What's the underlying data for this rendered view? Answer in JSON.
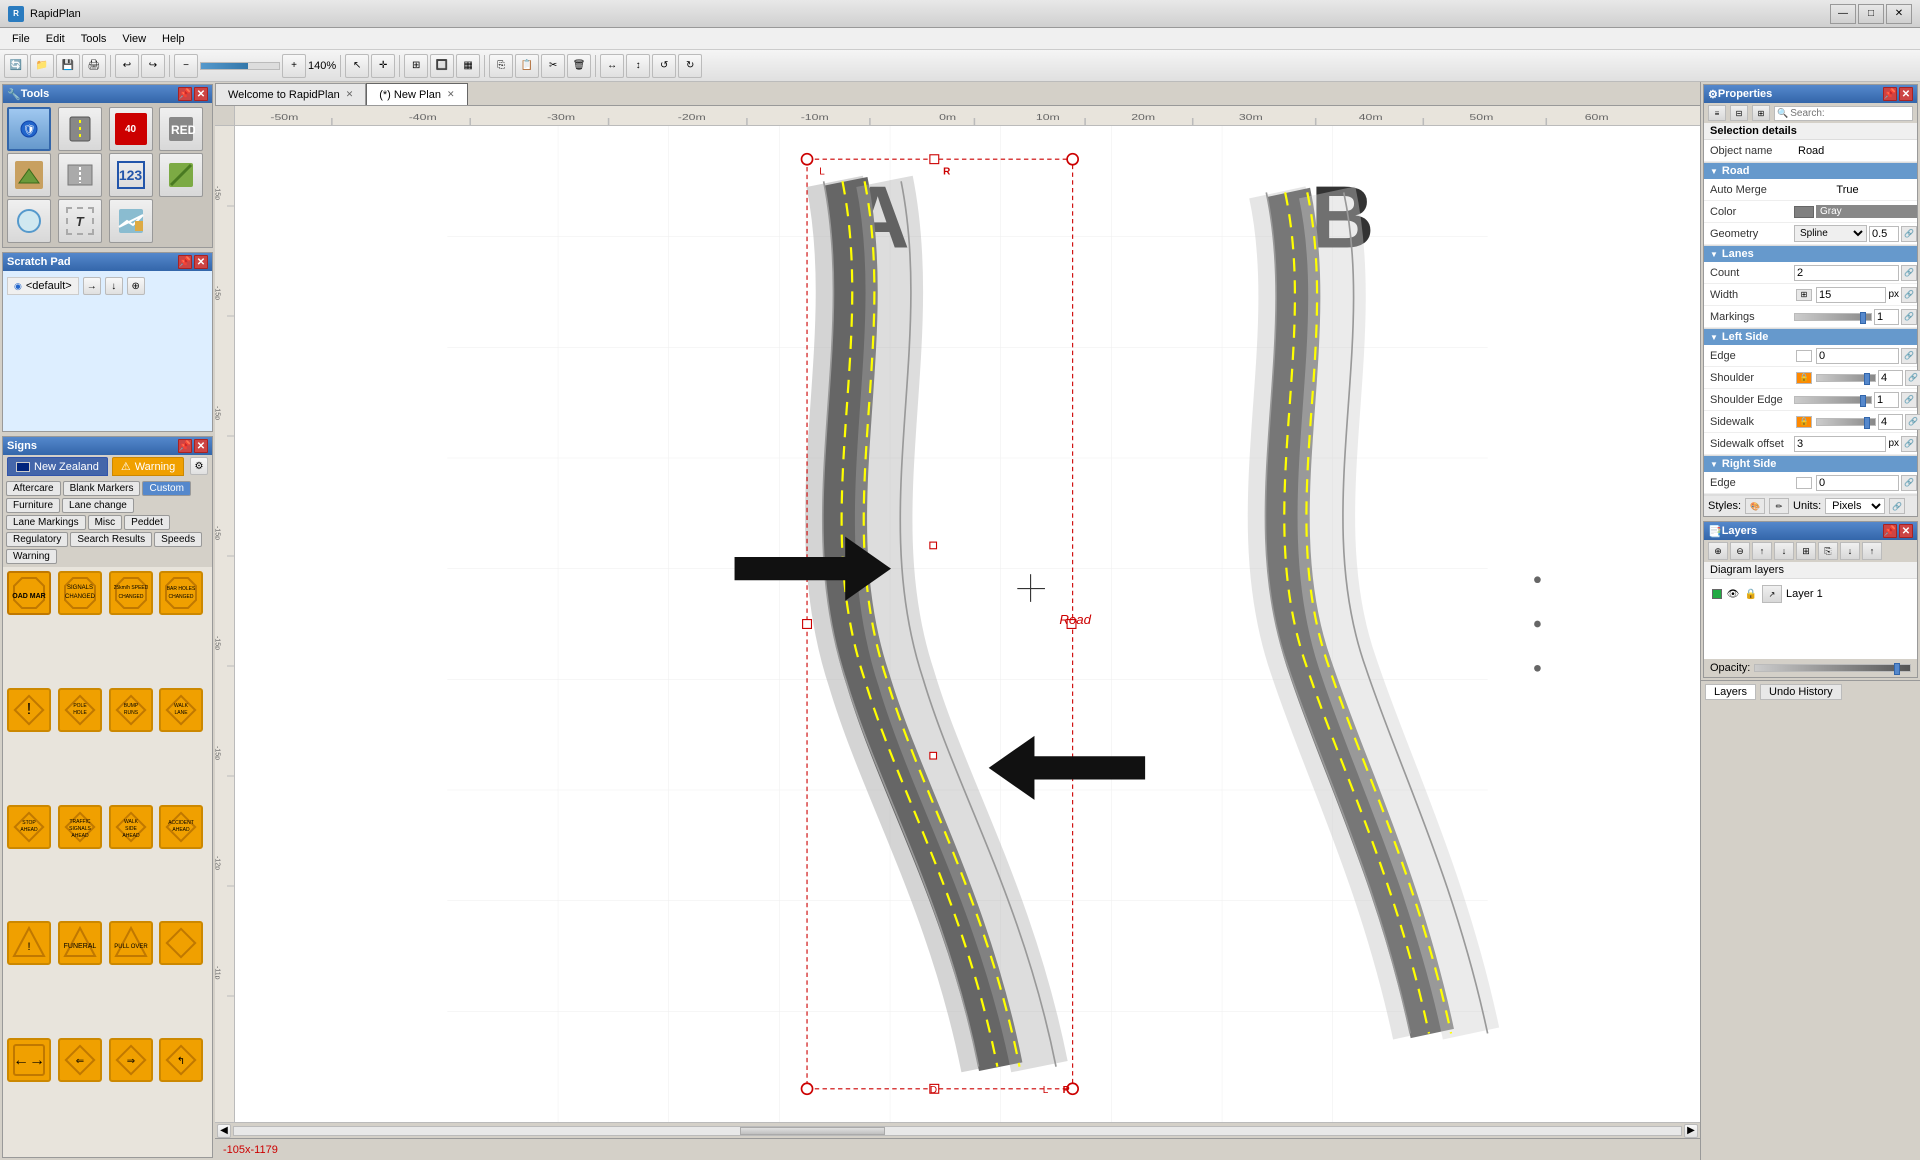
{
  "app": {
    "title": "RapidPlan",
    "window_controls": [
      "—",
      "□",
      "✕"
    ]
  },
  "menubar": {
    "items": [
      "File",
      "Edit",
      "Tools",
      "View",
      "Help"
    ]
  },
  "tabs": [
    {
      "label": "Welcome to RapidPlan",
      "closable": true,
      "active": false
    },
    {
      "label": "(*) New Plan",
      "closable": true,
      "active": true
    }
  ],
  "toolbar": {
    "zoom_label": "140%",
    "zoom_value": 70,
    "rulers": [
      "-50m",
      "-40m",
      "-30m",
      "-20m",
      "-10m",
      "0m",
      "10m",
      "20m",
      "30m",
      "40m",
      "50m",
      "60m"
    ],
    "v_rulers": [
      "-15p",
      "-15p",
      "-15p",
      "-15p",
      "-15p",
      "-15p",
      "-15p",
      "-15p",
      "-11p"
    ]
  },
  "tools_panel": {
    "title": "Tools",
    "tools": [
      {
        "icon": "🛡",
        "name": "select-tool"
      },
      {
        "icon": "🔲",
        "name": "road-tool"
      },
      {
        "icon": "🚦",
        "name": "sign-tool"
      },
      {
        "icon": "▦",
        "name": "hatch-tool"
      },
      {
        "icon": "🌿",
        "name": "terrain-tool"
      },
      {
        "icon": "≡",
        "name": "lane-tool"
      },
      {
        "icon": "#",
        "name": "number-tool"
      },
      {
        "icon": "╱",
        "name": "line-tool"
      },
      {
        "icon": "○",
        "name": "circle-tool"
      },
      {
        "icon": "T",
        "name": "text-tool"
      },
      {
        "icon": "🗺",
        "name": "map-tool"
      }
    ]
  },
  "scratch_pad": {
    "title": "Scratch Pad",
    "default_item": "<default>"
  },
  "signs_panel": {
    "title": "Signs",
    "tabs": [
      {
        "label": "New Zealand",
        "active": true,
        "type": "nz"
      },
      {
        "label": "Warning",
        "active": false,
        "type": "warning"
      }
    ],
    "categories": [
      "Aftercare",
      "Blank Markers",
      "Custom",
      "Furniture",
      "Lane change",
      "Lane Markings",
      "Misc",
      "Peddet",
      "Regulatory",
      "Search Results",
      "Speeds",
      "Warning"
    ],
    "active_category": "Warning",
    "signs_count": 20
  },
  "canvas": {
    "label_a": "A",
    "label_b": "B",
    "road_label": "Road",
    "coord": "-105x-1179"
  },
  "properties": {
    "title": "Properties",
    "search_placeholder": "Search:",
    "selection_details": {
      "label": "Selection details",
      "object_name_label": "Object name",
      "object_name_value": "Road"
    },
    "road_section": {
      "label": "Road",
      "auto_merge_label": "Auto Merge",
      "auto_merge_value": "True",
      "color_label": "Color",
      "color_value": "Gray",
      "geometry_label": "Geometry",
      "geometry_value": "Spline",
      "geometry_num": "0.5"
    },
    "lanes_section": {
      "label": "Lanes",
      "count_label": "Count",
      "count_value": "2",
      "width_label": "Width",
      "width_value": "15",
      "width_unit": "px",
      "markings_label": "Markings",
      "markings_value": "1"
    },
    "left_side_section": {
      "label": "Left Side",
      "edge_label": "Edge",
      "edge_value": "0",
      "shoulder_label": "Shoulder",
      "shoulder_value": "4",
      "shoulder_edge_label": "Shoulder Edge",
      "shoulder_edge_value": "1",
      "sidewalk_label": "Sidewalk",
      "sidewalk_value": "4",
      "sidewalk_offset_label": "Sidewalk offset",
      "sidewalk_offset_value": "3",
      "sidewalk_offset_unit": "px"
    },
    "right_side_section": {
      "label": "Right Side",
      "edge_label": "Edge",
      "edge_value": "0"
    },
    "styles_label": "Styles:",
    "units_label": "Units:",
    "units_value": "Pixels"
  },
  "layers": {
    "title": "Layers",
    "diagram_layers_label": "Diagram layers",
    "items": [
      {
        "name": "Layer 1",
        "visible": true,
        "locked": false,
        "color": "#22aa44"
      }
    ],
    "opacity_label": "Opacity:"
  },
  "bottom_tabs": [
    {
      "label": "Layers",
      "active": true
    },
    {
      "label": "Undo History",
      "active": false
    }
  ]
}
